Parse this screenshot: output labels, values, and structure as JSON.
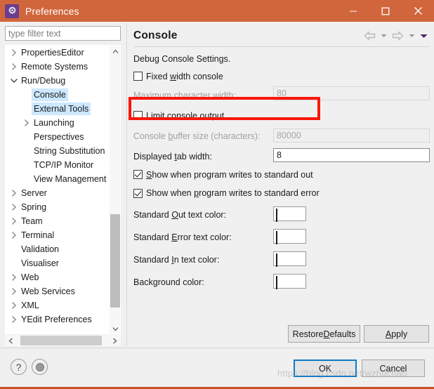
{
  "window": {
    "title": "Preferences",
    "app_icon": "gear-icon",
    "titlebar_color": "#d1663c",
    "controls": {
      "minimize": "—",
      "maximize": "☐",
      "close": "✕"
    }
  },
  "sidebar": {
    "filter": {
      "value": "",
      "placeholder": "type filter text"
    },
    "items": [
      {
        "label": "PropertiesEditor",
        "indent": 0,
        "twisty": "collapsed",
        "selected": false
      },
      {
        "label": "Remote Systems",
        "indent": 0,
        "twisty": "collapsed",
        "selected": false
      },
      {
        "label": "Run/Debug",
        "indent": 0,
        "twisty": "expanded",
        "selected": false
      },
      {
        "label": "Console",
        "indent": 1,
        "twisty": "none",
        "selected": true
      },
      {
        "label": "External Tools",
        "indent": 1,
        "twisty": "none",
        "selected": true
      },
      {
        "label": "Launching",
        "indent": 1,
        "twisty": "collapsed",
        "selected": false
      },
      {
        "label": "Perspectives",
        "indent": 1,
        "twisty": "none",
        "selected": false
      },
      {
        "label": "String Substitution",
        "indent": 1,
        "twisty": "none",
        "selected": false
      },
      {
        "label": "TCP/IP Monitor",
        "indent": 1,
        "twisty": "none",
        "selected": false
      },
      {
        "label": "View Management",
        "indent": 1,
        "twisty": "none",
        "selected": false
      },
      {
        "label": "Server",
        "indent": 0,
        "twisty": "collapsed",
        "selected": false
      },
      {
        "label": "Spring",
        "indent": 0,
        "twisty": "collapsed",
        "selected": false
      },
      {
        "label": "Team",
        "indent": 0,
        "twisty": "collapsed",
        "selected": false
      },
      {
        "label": "Terminal",
        "indent": 0,
        "twisty": "collapsed",
        "selected": false
      },
      {
        "label": "Validation",
        "indent": 0,
        "twisty": "none",
        "selected": false
      },
      {
        "label": "Visualiser",
        "indent": 0,
        "twisty": "none",
        "selected": false
      },
      {
        "label": "Web",
        "indent": 0,
        "twisty": "collapsed",
        "selected": false
      },
      {
        "label": "Web Services",
        "indent": 0,
        "twisty": "collapsed",
        "selected": false
      },
      {
        "label": "XML",
        "indent": 0,
        "twisty": "collapsed",
        "selected": false
      },
      {
        "label": "YEdit Preferences",
        "indent": 0,
        "twisty": "collapsed",
        "selected": false
      }
    ]
  },
  "content": {
    "title": "Console",
    "nav": {
      "back": "back-arrow-icon",
      "back_menu": "chevron-down-icon",
      "forward": "forward-arrow-icon",
      "forward_menu": "chevron-down-icon",
      "view_menu": "view-menu-icon"
    },
    "group_label": "Debug Console Settings.",
    "fixed_width": {
      "label_pre": "Fixed ",
      "label_mnemonic": "w",
      "label_post": "idth console",
      "checked": false
    },
    "max_char_width": {
      "label_pre": "M",
      "label_mnemonic": "a",
      "label_post": "ximum character width:",
      "value": "80",
      "enabled": false
    },
    "limit_output": {
      "label_pre": "",
      "label_mnemonic": "L",
      "label_post": "imit console output",
      "checked": false,
      "highlighted": true,
      "highlight_color": "#fa1608"
    },
    "buffer_size": {
      "label_pre": "Console ",
      "label_mnemonic": "b",
      "label_post": "uffer size (characters):",
      "value": "80000",
      "enabled": false
    },
    "tab_width": {
      "label_pre": "Displayed ",
      "label_mnemonic": "t",
      "label_post": "ab width:",
      "value": "8",
      "enabled": true
    },
    "show_stdout": {
      "label_pre": "",
      "label_mnemonic": "S",
      "label_post": "how when program writes to standard out",
      "checked": true
    },
    "show_stderr": {
      "label_pre": "Show when ",
      "label_mnemonic": "p",
      "label_post": "rogram writes to standard error",
      "checked": true
    },
    "colors": [
      {
        "label_pre": "Standard ",
        "label_mnemonic": "O",
        "label_post": "ut text color:",
        "color": "#000000",
        "name": "standard-out-color"
      },
      {
        "label_pre": "Standard ",
        "label_mnemonic": "E",
        "label_post": "rror text color:",
        "color": "#fe0000",
        "name": "standard-error-color"
      },
      {
        "label_pre": "Standard ",
        "label_mnemonic": "I",
        "label_post": "n text color:",
        "color": "#06c37c",
        "name": "standard-in-color"
      },
      {
        "label_pre": "Back",
        "label_mnemonic": "g",
        "label_post": "round color:",
        "color": "#ffffff",
        "name": "background-color"
      }
    ]
  },
  "buttons": {
    "restore_pre": "Restore ",
    "restore_mnemonic": "D",
    "restore_post": "efaults",
    "apply_pre": "",
    "apply_mnemonic": "A",
    "apply_post": "pply",
    "ok": "OK",
    "cancel": "Cancel"
  },
  "footer": {
    "help_icon": "?",
    "menu_icon": "disc-icon"
  },
  "watermark": "https://blog.csdn.net/wzhuchao"
}
